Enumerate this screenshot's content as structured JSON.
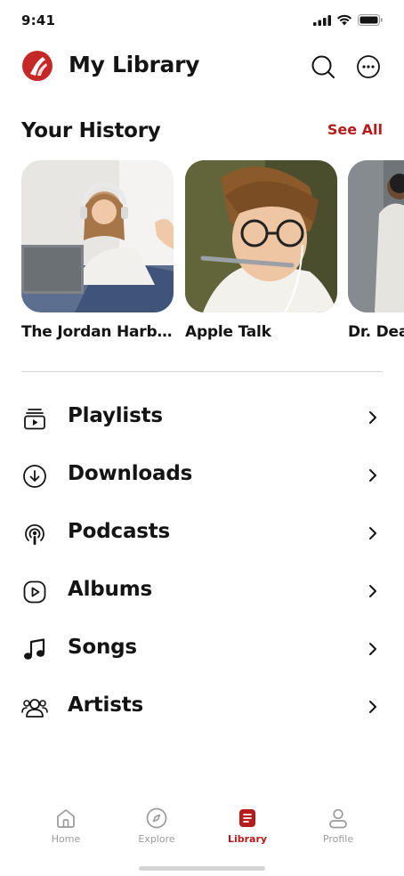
{
  "status": {
    "time": "9:41"
  },
  "header": {
    "title": "My Library"
  },
  "history": {
    "title": "Your History",
    "see_all": "See All",
    "items": [
      {
        "name": "The Jordan Harb..."
      },
      {
        "name": "Apple Talk"
      },
      {
        "name": "Dr. Dea"
      }
    ]
  },
  "menu": {
    "items": [
      {
        "label": "Playlists",
        "icon": "playlist-icon"
      },
      {
        "label": "Downloads",
        "icon": "download-icon"
      },
      {
        "label": "Podcasts",
        "icon": "podcast-icon"
      },
      {
        "label": "Albums",
        "icon": "album-icon"
      },
      {
        "label": "Songs",
        "icon": "music-note-icon"
      },
      {
        "label": "Artists",
        "icon": "artists-icon"
      }
    ]
  },
  "nav": {
    "items": [
      {
        "label": "Home",
        "icon": "home-icon",
        "active": false
      },
      {
        "label": "Explore",
        "icon": "compass-icon",
        "active": false
      },
      {
        "label": "Library",
        "icon": "library-icon",
        "active": true
      },
      {
        "label": "Profile",
        "icon": "profile-icon",
        "active": false
      }
    ]
  },
  "colors": {
    "accent": "#b71c1c",
    "text": "#141414",
    "muted": "#9a9a9a",
    "divider": "#d5d5d5"
  }
}
